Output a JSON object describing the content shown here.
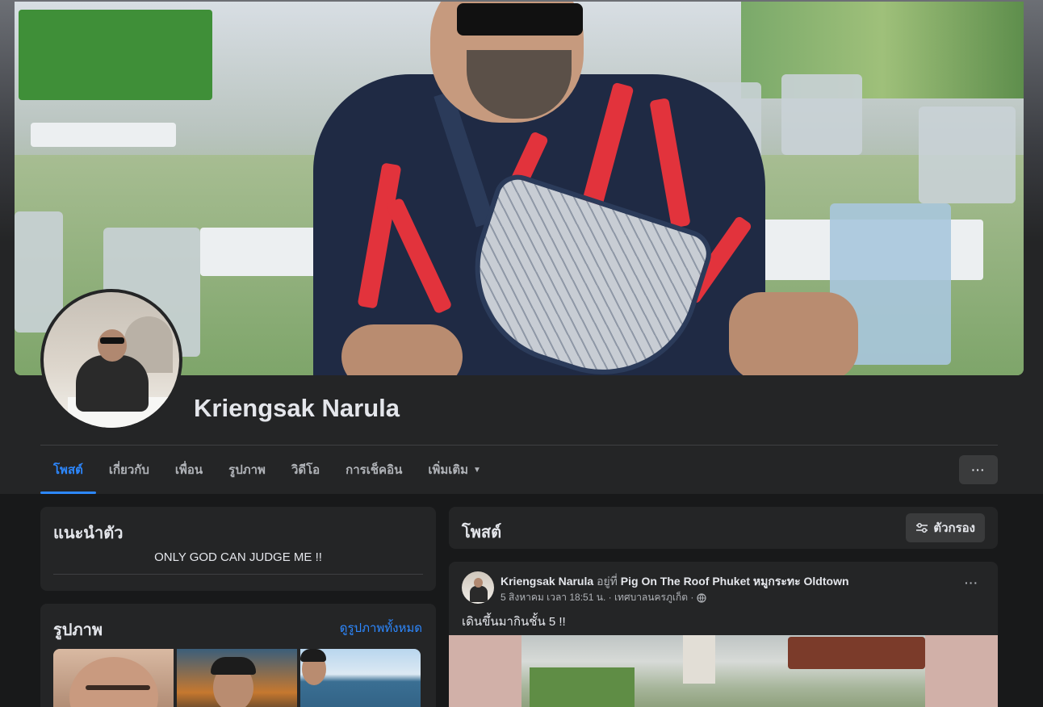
{
  "profile": {
    "name": "Kriengsak Narula"
  },
  "tabs": [
    {
      "label": "โพสต์",
      "active": true
    },
    {
      "label": "เกี่ยวกับ",
      "active": false
    },
    {
      "label": "เพื่อน",
      "active": false
    },
    {
      "label": "รูปภาพ",
      "active": false
    },
    {
      "label": "วิดีโอ",
      "active": false
    },
    {
      "label": "การเช็คอิน",
      "active": false
    },
    {
      "label": "เพิ่มเติม",
      "active": false
    }
  ],
  "more_button": {
    "label": "···"
  },
  "intro": {
    "title": "แนะนำตัว",
    "bio": "ONLY GOD CAN JUDGE ME !!"
  },
  "photos": {
    "title": "รูปภาพ",
    "see_all": "ดูรูปภาพทั้งหมด"
  },
  "posts": {
    "title": "โพสต์",
    "filter_label": "ตัวกรอง"
  },
  "post": {
    "author": "Kriengsak Narula",
    "at_text": "อยู่ที่",
    "place": "Pig On The Roof Phuket หมูกระทะ Oldtown",
    "timestamp": "5 สิงหาคม เวลา 18:51 น. · เทศบาลนครภูเก็ต ·",
    "text": "เดินขึ้นมากินชั้น 5 !!",
    "more": "···"
  },
  "colors": {
    "accent": "#2d88ff",
    "background": "#18191a",
    "card": "#242526"
  }
}
